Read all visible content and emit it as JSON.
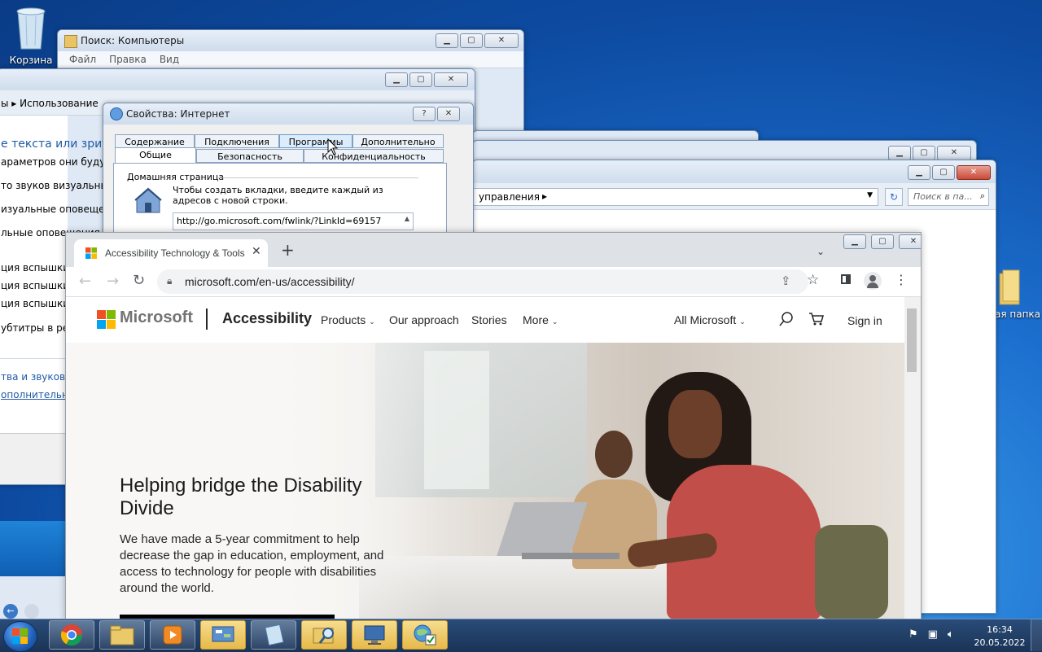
{
  "desktop": {
    "recycle_bin_label": "Корзина",
    "new_folder_label": "ая папка"
  },
  "search_window": {
    "title": "Поиск: Компьютеры",
    "menu": [
      "Файл",
      "Правка",
      "Вид"
    ]
  },
  "control_window": {
    "breadcrumb_part": "ы ▸  Использование",
    "heading": "е текста или зрите",
    "lines": [
      "араметров они будут за",
      "то звуков визуальные с",
      "изуальные оповещени",
      "льные оповещения",
      "ция вспышки д",
      "ция вспышки в",
      "ция вспышки д",
      "убтитры в рече"
    ],
    "links": [
      "тва и звуковые",
      "ополнительны"
    ]
  },
  "panel_window": {
    "address": "управления",
    "search_placeholder": "Поиск в па..."
  },
  "inet_props": {
    "title": "Свойства: Интернет",
    "tabs_back": [
      "Содержание",
      "Подключения",
      "Программы",
      "Дополнительно"
    ],
    "tabs_front": [
      "Общие",
      "Безопасность",
      "Конфиденциальность"
    ],
    "home_label": "Домашняя страница",
    "home_desc": "Чтобы создать вкладки, введите каждый из адресов с новой строки.",
    "home_url": "http://go.microsoft.com/fwlink/?LinkId=69157"
  },
  "browser": {
    "tab_title": "Accessibility Technology & Tools",
    "url": "microsoft.com/en-us/accessibility/",
    "site": {
      "brand": "Microsoft",
      "section": "Accessibility",
      "nav": [
        {
          "label": "Products",
          "dropdown": true
        },
        {
          "label": "Our approach",
          "dropdown": false
        },
        {
          "label": "Stories",
          "dropdown": false
        },
        {
          "label": "More",
          "dropdown": true
        }
      ],
      "all_microsoft": "All Microsoft",
      "sign_in": "Sign in",
      "hero_title": "Helping bridge the Disability Divide",
      "hero_text": "We have made a 5-year commitment to help decrease the gap in education, employment, and access to technology for people with disabilities around the world."
    }
  },
  "taskbar": {
    "time": "16:34",
    "date": "20.05.2022"
  },
  "colors": {
    "ms_red": "#f25022",
    "ms_green": "#7fba00",
    "ms_blue": "#00a4ef",
    "ms_yellow": "#ffb900"
  }
}
